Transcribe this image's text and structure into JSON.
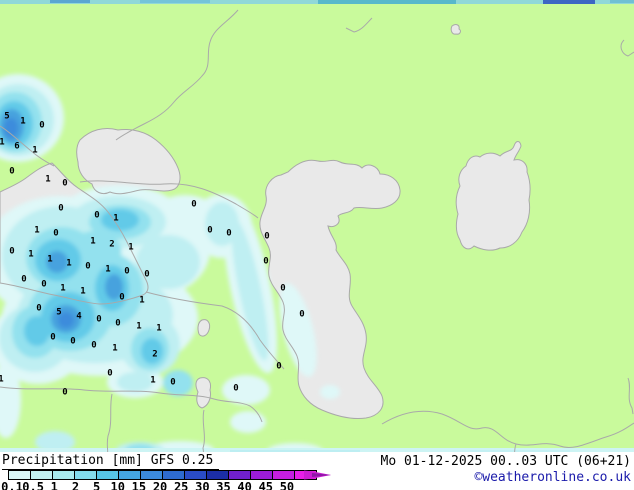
{
  "map": {
    "land_color": "#c9fa9c",
    "sea_color": "#e9e9e9",
    "coast_color": "#a9a9a9",
    "edge_strip_color": "#90d8d8",
    "bottom_strip_color": "#cdf4f4",
    "layer_colors": [
      "#dff8f8",
      "#bfeff2",
      "#93e1ee",
      "#62cae8",
      "#46a2de",
      "#3c8cdc"
    ],
    "grid_values": [
      [
        7,
        117,
        "5"
      ],
      [
        23,
        122,
        "1"
      ],
      [
        42,
        126,
        "0"
      ],
      [
        2,
        143,
        "1"
      ],
      [
        17,
        147,
        "6"
      ],
      [
        35,
        151,
        "1"
      ],
      [
        12,
        172,
        "0"
      ],
      [
        48,
        180,
        "1"
      ],
      [
        65,
        184,
        "0"
      ],
      [
        61,
        209,
        "0"
      ],
      [
        97,
        216,
        "0"
      ],
      [
        116,
        219,
        "1"
      ],
      [
        194,
        205,
        "0"
      ],
      [
        37,
        231,
        "1"
      ],
      [
        56,
        234,
        "0"
      ],
      [
        93,
        242,
        "1"
      ],
      [
        112,
        245,
        "2"
      ],
      [
        131,
        248,
        "1"
      ],
      [
        210,
        231,
        "0"
      ],
      [
        229,
        234,
        "0"
      ],
      [
        267,
        237,
        "0"
      ],
      [
        12,
        252,
        "0"
      ],
      [
        31,
        255,
        "1"
      ],
      [
        50,
        260,
        "1"
      ],
      [
        69,
        264,
        "1"
      ],
      [
        88,
        267,
        "0"
      ],
      [
        108,
        270,
        "1"
      ],
      [
        127,
        272,
        "0"
      ],
      [
        147,
        275,
        "0"
      ],
      [
        266,
        262,
        "0"
      ],
      [
        24,
        280,
        "0"
      ],
      [
        44,
        285,
        "0"
      ],
      [
        63,
        289,
        "1"
      ],
      [
        83,
        292,
        "1"
      ],
      [
        122,
        298,
        "0"
      ],
      [
        142,
        301,
        "1"
      ],
      [
        283,
        289,
        "0"
      ],
      [
        39,
        309,
        "0"
      ],
      [
        59,
        313,
        "5"
      ],
      [
        79,
        317,
        "4"
      ],
      [
        99,
        320,
        "0"
      ],
      [
        118,
        324,
        "0"
      ],
      [
        139,
        327,
        "1"
      ],
      [
        159,
        329,
        "1"
      ],
      [
        302,
        315,
        "0"
      ],
      [
        53,
        338,
        "0"
      ],
      [
        73,
        342,
        "0"
      ],
      [
        94,
        346,
        "0"
      ],
      [
        115,
        349,
        "1"
      ],
      [
        155,
        355,
        "2"
      ],
      [
        110,
        374,
        "0"
      ],
      [
        1,
        380,
        "1"
      ],
      [
        153,
        381,
        "1"
      ],
      [
        173,
        383,
        "0"
      ],
      [
        279,
        367,
        "0"
      ],
      [
        65,
        393,
        "0"
      ],
      [
        236,
        389,
        "0"
      ]
    ]
  },
  "legend": {
    "title": "Precipitation [mm] GFS 0.25",
    "stops": [
      {
        "label": "0.1",
        "color": "#d9f7f7"
      },
      {
        "label": "0.5",
        "color": "#c2f1f1"
      },
      {
        "label": "1",
        "color": "#a9ebee"
      },
      {
        "label": "2",
        "color": "#83dbec"
      },
      {
        "label": "5",
        "color": "#57c5e6"
      },
      {
        "label": "10",
        "color": "#44a4e0"
      },
      {
        "label": "15",
        "color": "#3c8adc"
      },
      {
        "label": "20",
        "color": "#2e6bd0"
      },
      {
        "label": "25",
        "color": "#2a4cc6"
      },
      {
        "label": "30",
        "color": "#1c2ea6"
      },
      {
        "label": "35",
        "color": "#7020cc"
      },
      {
        "label": "40",
        "color": "#9c1cd8"
      },
      {
        "label": "45",
        "color": "#c61ee0"
      },
      {
        "label": "50",
        "color": "#e81ee8"
      }
    ],
    "arrow_colors": [
      "#cc1cd4",
      "#8d17a6"
    ]
  },
  "footer": {
    "timestamp": "Mo 01-12-2025 00..03 UTC (06+21)",
    "copyright": "©weatheronline.co.uk",
    "copyright_color": "#1a1aaa"
  }
}
